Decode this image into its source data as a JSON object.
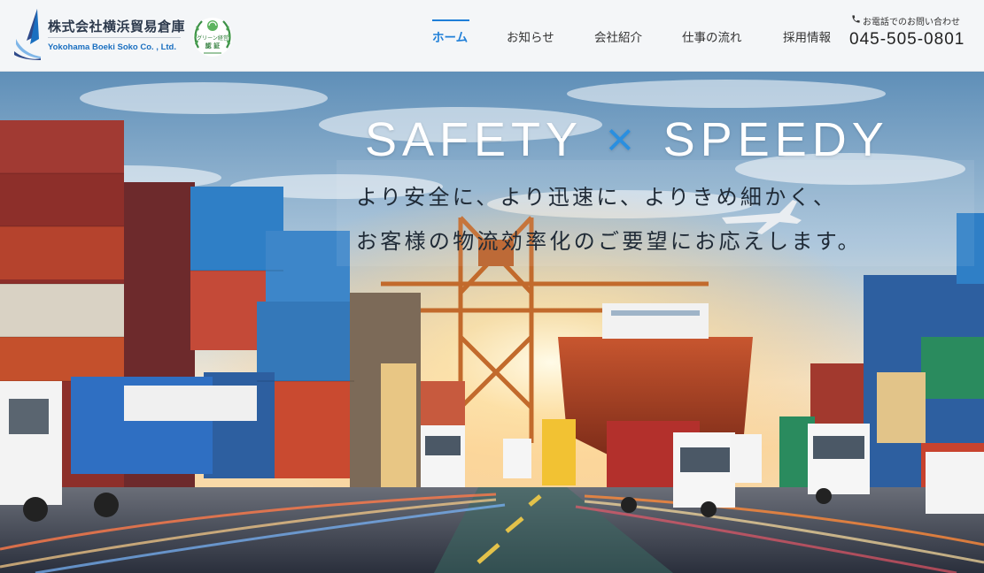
{
  "header": {
    "company_name_ja": "株式会社横浜貿易倉庫",
    "company_name_en": "Yokohama Boeki Soko Co. , Ltd.",
    "badge": {
      "icon": "green-certification-badge",
      "top_text": "グリーン経営",
      "bottom_text": "認 証"
    }
  },
  "nav": {
    "items": [
      {
        "label": "ホーム",
        "active": true
      },
      {
        "label": "お知らせ",
        "active": false
      },
      {
        "label": "会社紹介",
        "active": false
      },
      {
        "label": "仕事の流れ",
        "active": false
      },
      {
        "label": "採用情報",
        "active": false
      }
    ]
  },
  "contact": {
    "label": "お電話でのお問い合わせ",
    "phone": "045-505-0801",
    "icon": "phone-icon"
  },
  "hero": {
    "title_left": "SAFETY",
    "title_cross": "×",
    "title_right": "SPEEDY",
    "line1": "より安全に、より迅速に、よりきめ細かく、",
    "line2": "お客様の物流効率化のご要望にお応えします。",
    "image": "container-port-with-crane-ship-trucks"
  },
  "colors": {
    "accent": "#1f7fd8",
    "brand_navy": "#2d3a4d",
    "header_bg": "#f4f6f8"
  }
}
